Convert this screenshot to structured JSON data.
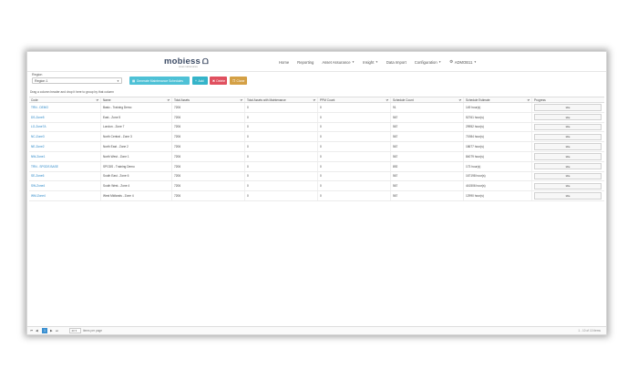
{
  "header": {
    "logo": "mobiess",
    "logo_mark": "ᗝ",
    "logo_sub": "asset maintenance",
    "nav": [
      {
        "label": "Home",
        "caret": false
      },
      {
        "label": "Reporting",
        "caret": false
      },
      {
        "label": "Asset Assurance",
        "caret": true
      },
      {
        "label": "Insight",
        "caret": true
      },
      {
        "label": "Data Import",
        "caret": false
      },
      {
        "label": "Configuration",
        "caret": true
      }
    ],
    "user": "ADMOB11",
    "user_icon": "user-icon"
  },
  "toolbar": {
    "region_label": "Region",
    "region_value": "Region 1",
    "generate_label": "Generate Maintenance Schedules",
    "add_label": "Add",
    "delete_label": "Delete",
    "clone_label": "Clone"
  },
  "grid": {
    "group_hint": "Drag a column header and drop it here to group by that column",
    "columns": [
      "Code",
      "Name",
      "Total Assets",
      "Total Assets with Maintenance",
      "PPM Count",
      "Schedule Count",
      "Schedule Estimate",
      "Progress"
    ],
    "rows": [
      {
        "code": "TRN - DEMO",
        "name": "Basic - Training Demo",
        "total": "7206",
        "with_maint": "0",
        "ppm": "0",
        "schedule_count": "91",
        "estimate": "149 hour(s)",
        "progress": "Idle"
      },
      {
        "code": "DS-Zone5",
        "name": "East - Zone 5",
        "total": "7206",
        "with_maint": "0",
        "ppm": "0",
        "schedule_count": "567",
        "estimate": "52761 hour(s)",
        "progress": "Idle"
      },
      {
        "code": "LO-Zone7A",
        "name": "London - Zone 7",
        "total": "7206",
        "with_maint": "0",
        "ppm": "0",
        "schedule_count": "567",
        "estimate": "29952 hour(s)",
        "progress": "Idle"
      },
      {
        "code": "NC-Zone3",
        "name": "North Central - Zone 3",
        "total": "7206",
        "with_maint": "0",
        "ppm": "0",
        "schedule_count": "567",
        "estimate": "71984 hour(s)",
        "progress": "Idle"
      },
      {
        "code": "NE-Zone2",
        "name": "North East - Zone 2",
        "total": "7206",
        "with_maint": "0",
        "ppm": "0",
        "schedule_count": "567",
        "estimate": "18677 hour(s)",
        "progress": "Idle"
      },
      {
        "code": "NW-Zone1",
        "name": "North West - Zone 1",
        "total": "7206",
        "with_maint": "0",
        "ppm": "0",
        "schedule_count": "567",
        "estimate": "84079 hour(s)",
        "progress": "Idle"
      },
      {
        "code": "TRN - SPGDS BASE",
        "name": "SPGDS - Training Demo",
        "total": "7206",
        "with_maint": "0",
        "ppm": "0",
        "schedule_count": "892",
        "estimate": "173 hour(s)",
        "progress": "Idle"
      },
      {
        "code": "SE-Zone6",
        "name": "South East - Zone 6",
        "total": "7206",
        "with_maint": "0",
        "ppm": "0",
        "schedule_count": "567",
        "estimate": "167198 hour(s)",
        "progress": "Idle"
      },
      {
        "code": "SW-Zone4",
        "name": "South West - Zone 4",
        "total": "7206",
        "with_maint": "0",
        "ppm": "0",
        "schedule_count": "567",
        "estimate": "441506 hour(s)",
        "progress": "Idle"
      },
      {
        "code": "WM-Zone4",
        "name": "West Midlands - Zone 4",
        "total": "7206",
        "with_maint": "0",
        "ppm": "0",
        "schedule_count": "567",
        "estimate": "12990 hour(s)",
        "progress": "Idle"
      }
    ]
  },
  "pager": {
    "page": "1",
    "page_size": "20",
    "items_per_page_label": "items per page",
    "info": "1 - 10 of 10 items"
  },
  "colors": {
    "generate": "#4ec1d6",
    "add": "#35b4c9",
    "delete": "#e0505f",
    "clone": "#d4a045",
    "link": "#2a87c8",
    "pager_active": "#3a8fd0"
  }
}
